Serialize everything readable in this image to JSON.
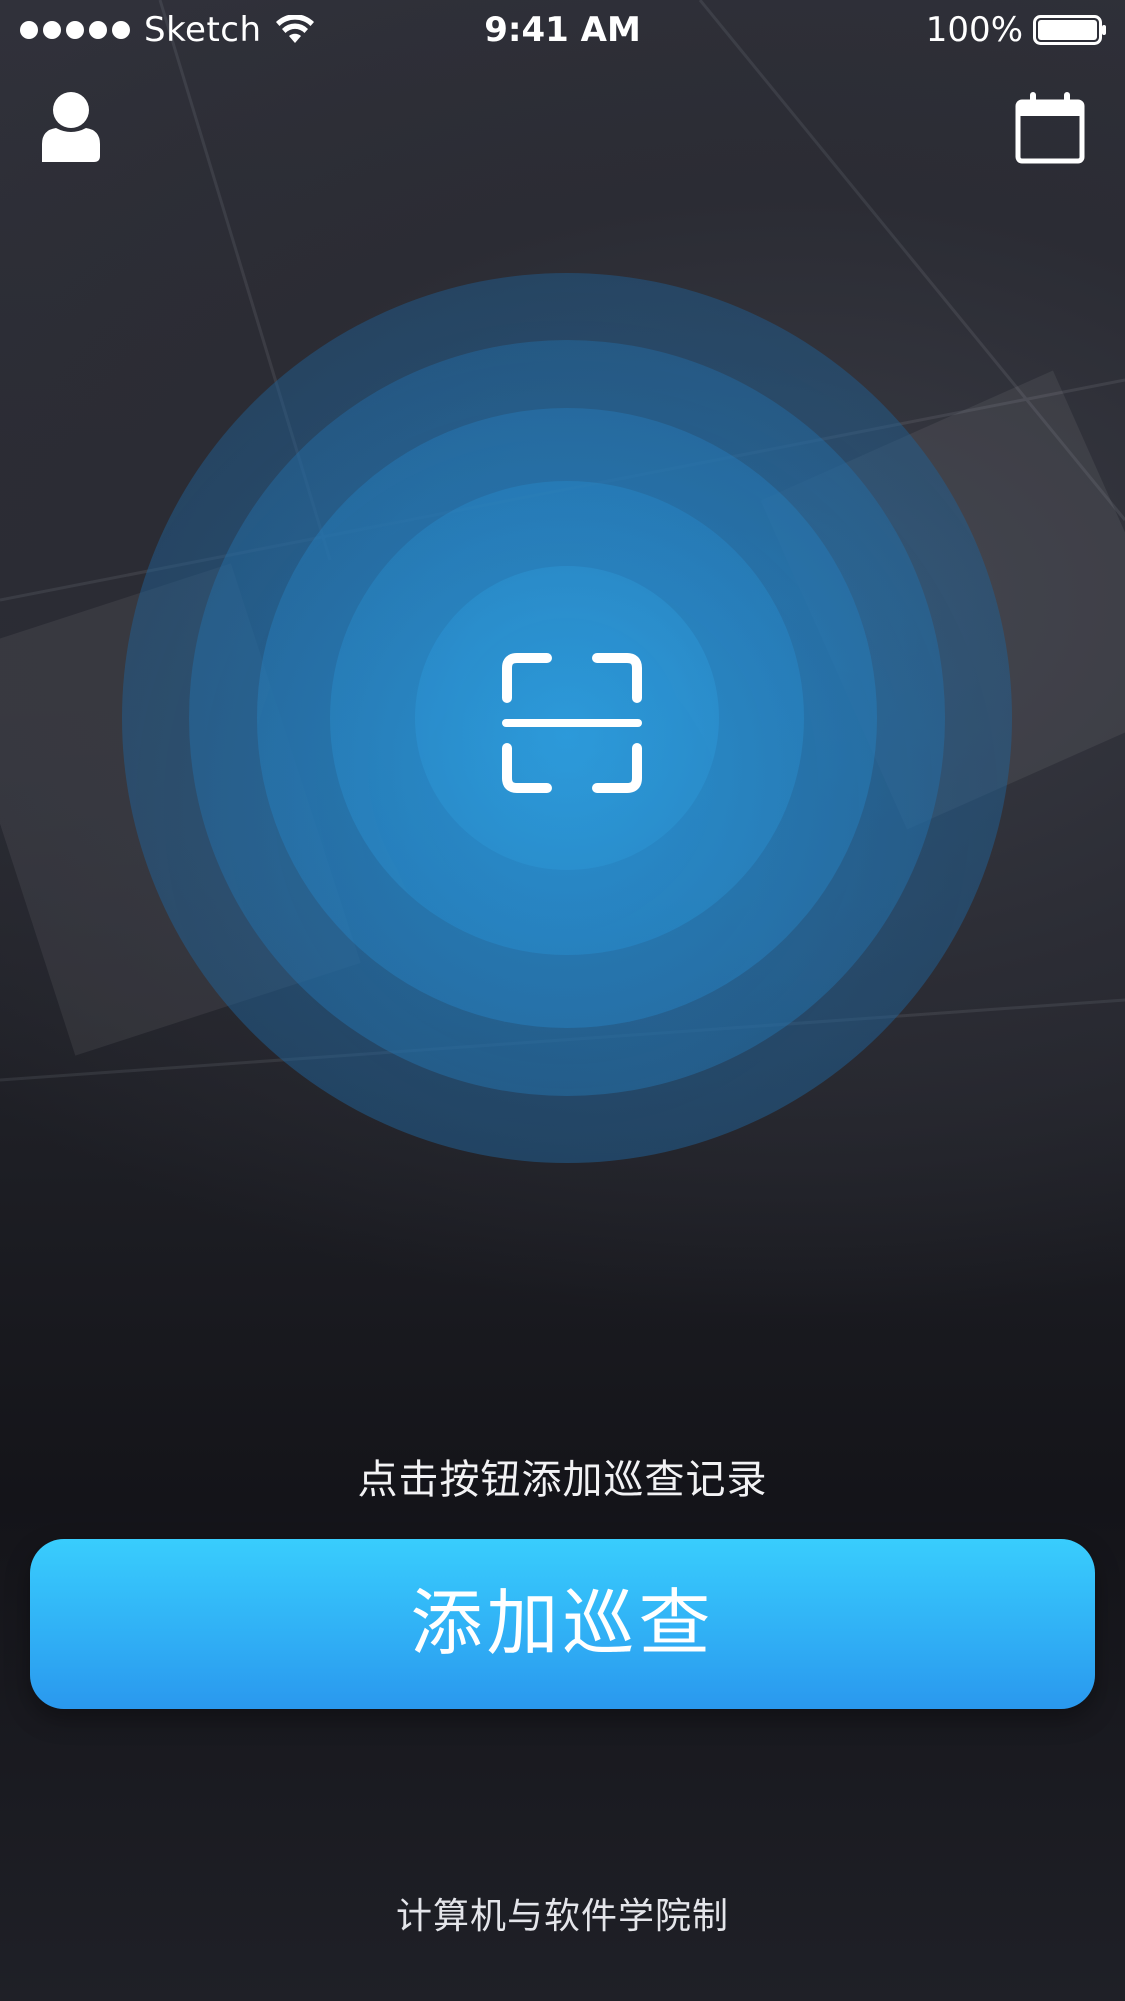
{
  "status_bar": {
    "carrier": "Sketch",
    "time": "9:41 AM",
    "battery": "100%",
    "signal_bars": 5,
    "icons": [
      "signal-dots-icon",
      "wifi-icon",
      "battery-icon"
    ]
  },
  "nav": {
    "left_icon": "user-icon",
    "right_icon": "calendar-icon"
  },
  "scanner": {
    "icon": "scan-icon",
    "accent": "#2e9ee0"
  },
  "prompt": "点击按钮添加巡查记录",
  "primary_button": {
    "label": "添加巡查",
    "color_top": "#39cdfd",
    "color_bottom": "#2a98ee"
  },
  "footer": "计算机与软件学院制"
}
